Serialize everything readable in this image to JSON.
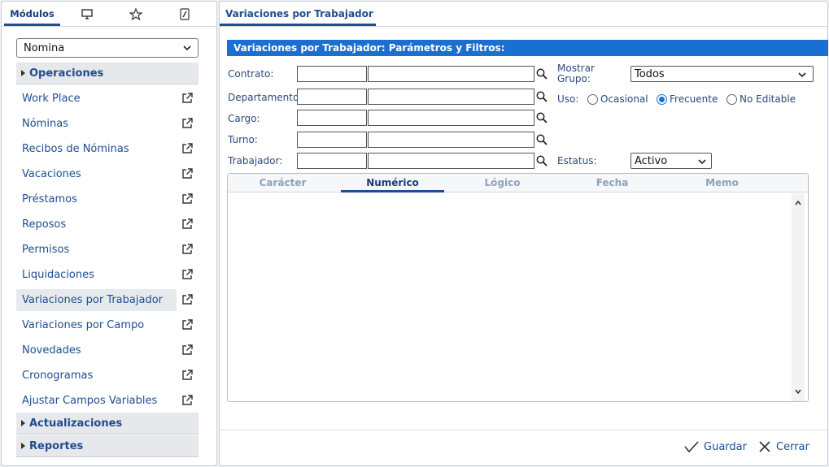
{
  "left_panel": {
    "tabs": {
      "modules_label": "Módulos",
      "desktop_icon": "monitor-icon",
      "favorites_icon": "star-icon",
      "tools_icon": "wrench-icon"
    },
    "module_select": {
      "value": "Nomina"
    },
    "sections": {
      "operaciones": "Operaciones",
      "actualizaciones": "Actualizaciones",
      "reportes": "Reportes"
    },
    "menu": [
      "Work Place",
      "Nóminas",
      "Recibos de Nóminas",
      "Vacaciones",
      "Préstamos",
      "Reposos",
      "Permisos",
      "Liquidaciones",
      "Variaciones por Trabajador",
      "Variaciones por Campo",
      "Novedades",
      "Cronogramas",
      "Ajustar Campos Variables"
    ]
  },
  "right_panel": {
    "tab_title": "Variaciones por Trabajador",
    "section_title": "Variaciones por Trabajador: Parámetros y Filtros:",
    "filters": {
      "contrato": "Contrato:",
      "departamento": "Departamento",
      "cargo": "Cargo:",
      "turno": "Turno:",
      "trabajador": "Trabajador:"
    },
    "mostrar_grupo": {
      "label_line1": "Mostrar",
      "label_line2": "Grupo:",
      "value": "Todos"
    },
    "uso": {
      "label": "Uso:",
      "options": [
        "Ocasional",
        "Frecuente",
        "No Editable"
      ],
      "selected": "Frecuente"
    },
    "estatus": {
      "label": "Estatus:",
      "value": "Activo"
    },
    "grid_tabs": [
      "Carácter",
      "Numérico",
      "Lógico",
      "Fecha",
      "Memo"
    ],
    "active_grid_tab": "Numérico",
    "buttons": {
      "save": "Guardar",
      "close": "Cerrar"
    }
  },
  "colors": {
    "accent": "#1a6fd1",
    "link": "#1f4d8f",
    "tab_underline": "#1c4d94"
  }
}
